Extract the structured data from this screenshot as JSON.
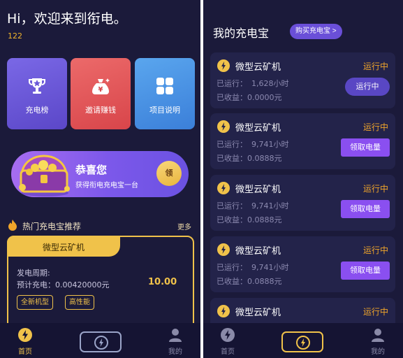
{
  "left": {
    "greeting": "Hi，欢迎来到衔电。",
    "user_number": "122",
    "tiles": [
      {
        "label": "充电榜",
        "icon": "trophy-icon"
      },
      {
        "label": "邀请赚钱",
        "icon": "money-bag-icon"
      },
      {
        "label": "项目说明",
        "icon": "grid-icon"
      }
    ],
    "banner": {
      "title": "恭喜您",
      "subtitle": "获得衔电充电宝一台",
      "button": "领"
    },
    "hot_section": {
      "title": "热门充电宝推荐",
      "more": "更多"
    },
    "product": {
      "name": "微型云矿机",
      "cycle_label": "发电周期:",
      "charge_label": "预计充电：0.00420000元",
      "price": "10.00",
      "tags": [
        "全新机型",
        "高性能"
      ]
    },
    "nav": {
      "home": "首页",
      "mine": "我的"
    }
  },
  "right": {
    "title": "我的充电宝",
    "buy_button": "购买充电宝 >",
    "devices": [
      {
        "name": "微型云矿机",
        "status": "运行中",
        "run_label": "已运行：",
        "run_value": "1,628小时",
        "earn_label": "已收益：",
        "earn_value": "0.0000元",
        "button": "运行中",
        "button_kind": "running"
      },
      {
        "name": "微型云矿机",
        "status": "运行中",
        "run_label": "已运行：",
        "run_value": "9,741小时",
        "earn_label": "已收益：",
        "earn_value": "0.0888元",
        "button": "领取电量",
        "button_kind": "claim"
      },
      {
        "name": "微型云矿机",
        "status": "运行中",
        "run_label": "已运行：",
        "run_value": "9,741小时",
        "earn_label": "已收益：",
        "earn_value": "0.0888元",
        "button": "领取电量",
        "button_kind": "claim"
      },
      {
        "name": "微型云矿机",
        "status": "运行中",
        "run_label": "已运行：",
        "run_value": "9,741小时",
        "earn_label": "已收益：",
        "earn_value": "0.0888元",
        "button": "领取电量",
        "button_kind": "claim"
      },
      {
        "name": "微型云矿机",
        "status": "运行中",
        "run_label": "",
        "run_value": "",
        "earn_label": "",
        "earn_value": "",
        "button": "",
        "button_kind": "none"
      }
    ],
    "nav": {
      "home": "首页",
      "mine": "我的"
    }
  },
  "colors": {
    "background": "#1b1a3a",
    "accent_gold": "#f0c24a",
    "status_orange": "#f0a52a",
    "button_purple": "#8a4ff0"
  }
}
